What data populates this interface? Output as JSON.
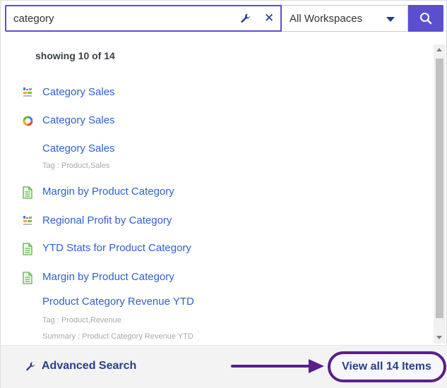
{
  "search": {
    "value": "category",
    "scope_selected": "All Workspaces"
  },
  "results": {
    "summary": "showing 10 of 14",
    "items": [
      {
        "title": "Category Sales",
        "icon": "visualization-icon"
      },
      {
        "title": "Category Sales",
        "icon": "donut-chart-icon"
      },
      {
        "title": "Category Sales",
        "tag": "Tag : Product,Sales"
      },
      {
        "title": "Margin by Product Category",
        "icon": "report-document-icon"
      },
      {
        "title": "Regional Profit by Category",
        "icon": "visualization-icon"
      },
      {
        "title": "YTD Stats for Product Category",
        "icon": "report-document-icon"
      },
      {
        "title": "Margin by Product Category",
        "icon": "report-document-icon"
      },
      {
        "title": "Product Category Revenue YTD",
        "tag": "Tag : Product,Revenue",
        "summary": "Summary : Product Category Revenue YTD"
      }
    ]
  },
  "footer": {
    "advanced_search": "Advanced Search",
    "view_all": "View all 14 Items"
  },
  "colors": {
    "accent": "#5b4fcf",
    "link": "#2f5fd3",
    "highlight_outline": "#5a1f8b"
  }
}
